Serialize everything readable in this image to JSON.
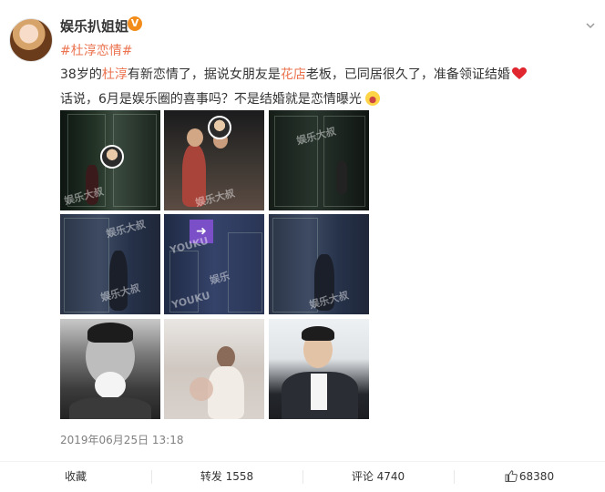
{
  "post": {
    "author": "娱乐扒姐姐",
    "verified_badge": "V",
    "topic": "#杜淳恋情#",
    "line1_a": "38岁的",
    "line1_name": "杜淳",
    "line1_b": "有新恋情了，据说女朋友是",
    "line1_shop": "花店",
    "line1_c": "老板，已同居很久了，准备领证结婚",
    "line2": "话说，6月是娱乐圈的喜事吗？不是结婚就是恋情曝光",
    "timestamp": "2019年06月25日 13:18",
    "watermarks": [
      "娱乐大叔",
      "YOUKU",
      "娱乐"
    ],
    "sign_arrow": "➜"
  },
  "actions": {
    "favorite": "收藏",
    "repost": "转发 1558",
    "comment": "评论 4740",
    "like_count": "68380"
  },
  "colors": {
    "accent": "#eb7350",
    "badge": "#f28c1b",
    "muted": "#808080"
  },
  "icons": [
    "chevron-down-icon",
    "verified-icon",
    "heart-icon",
    "laugh-emoji-icon",
    "like-icon"
  ]
}
